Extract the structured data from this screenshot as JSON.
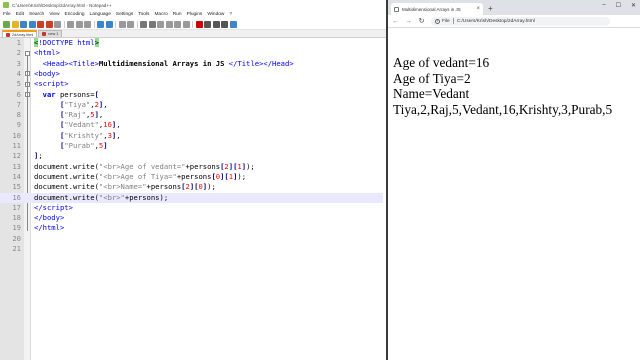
{
  "npp": {
    "window_title": "C:\\Users\\Krish\\Desktop\\2dArray.html - Notepad++",
    "menu": [
      "File",
      "Edit",
      "Search",
      "View",
      "Encoding",
      "Language",
      "Settings",
      "Tools",
      "Macro",
      "Run",
      "Plugins",
      "Window",
      "?"
    ],
    "tabs": [
      {
        "label": "2dArray.html",
        "active": true
      },
      {
        "label": "new 1",
        "active": false
      }
    ],
    "current_line": 16,
    "lines": [
      {
        "n": "1",
        "html": "<span class=\"hl-bracket\">&lt;</span><span class=\"tag\">!DOCTYPE html</span><span class=\"hl-bracket\">&gt;</span>"
      },
      {
        "n": "2",
        "html": "<span class=\"tag\">&lt;html&gt;</span>"
      },
      {
        "n": "3",
        "html": "  <span class=\"tag\">&lt;Head&gt;&lt;Title&gt;</span><b>Multidimensional Arrays in JS</b> <span class=\"tag\">&lt;/Title&gt;&lt;/Head&gt;</span>"
      },
      {
        "n": "4",
        "html": "<span class=\"tag\">&lt;body&gt;</span>"
      },
      {
        "n": "5",
        "html": "<span class=\"tag\">&lt;script&gt;</span>"
      },
      {
        "n": "6",
        "html": "  <span class=\"kw\">var</span> persons=<span class=\"op\">[</span>"
      },
      {
        "n": "7",
        "html": "      <span class=\"op\">[</span><span class=\"str\">\"Tiya\"</span>,<span class=\"num\">2</span><span class=\"op\">]</span>,"
      },
      {
        "n": "8",
        "html": "      <span class=\"op\">[</span><span class=\"str\">\"Raj\"</span>,<span class=\"num\">5</span><span class=\"op\">]</span>,"
      },
      {
        "n": "9",
        "html": "      <span class=\"op\">[</span><span class=\"str\">\"Vedant\"</span>,<span class=\"num\">16</span><span class=\"op\">]</span>,"
      },
      {
        "n": "10",
        "html": "      <span class=\"op\">[</span><span class=\"str\">\"Krishty\"</span>,<span class=\"num\">3</span><span class=\"op\">]</span>,"
      },
      {
        "n": "11",
        "html": "      <span class=\"op\">[</span><span class=\"str\">\"Purab\"</span>,<span class=\"num\">5</span><span class=\"op\">]</span>"
      },
      {
        "n": "12",
        "html": "<span class=\"op\">]</span>;"
      },
      {
        "n": "13",
        "html": "document.write(<span class=\"str\">\"&lt;br&gt;Age of vedant=\"</span>+persons<span class=\"op\">[</span><span class=\"num\">2</span><span class=\"op\">][</span><span class=\"num\">1</span><span class=\"op\">]</span>);"
      },
      {
        "n": "14",
        "html": "document.write(<span class=\"str\">\"&lt;br&gt;Age of Tiya=\"</span>+persons<span class=\"op\">[</span><span class=\"num\">0</span><span class=\"op\">][</span><span class=\"num\">1</span><span class=\"op\">]</span>);"
      },
      {
        "n": "15",
        "html": "document.write(<span class=\"str\">\"&lt;br&gt;Name=\"</span>+persons<span class=\"op\">[</span><span class=\"num\">2</span><span class=\"op\">][</span><span class=\"num\">0</span><span class=\"op\">]</span>);"
      },
      {
        "n": "16",
        "html": "document.write(<span class=\"str\">\"&lt;br&gt;\"</span>+persons);"
      },
      {
        "n": "17",
        "html": "<span class=\"tag\">&lt;/script&gt;</span>"
      },
      {
        "n": "18",
        "html": "<span class=\"tag\">&lt;/body&gt;</span>"
      },
      {
        "n": "19",
        "html": "<span class=\"tag\">&lt;/html&gt;</span>"
      },
      {
        "n": "20",
        "html": ""
      },
      {
        "n": "21",
        "html": ""
      }
    ]
  },
  "browser": {
    "tab_title": "Multidimensional Arrays in JS",
    "tab_close": "×",
    "new_tab": "+",
    "window_controls": [
      "–",
      "☐",
      "✕"
    ],
    "nav": {
      "back": "←",
      "forward": "→",
      "reload": "↻"
    },
    "address_prefix": "File",
    "address": "C:/Users/Krish/Desktop/2dArray.html",
    "output": [
      "Age of vedant=16",
      "Age of Tiya=2",
      "Name=Vedant",
      "Tiya,2,Raj,5,Vedant,16,Krishty,3,Purab,5"
    ]
  },
  "colors": {
    "editor_gutter": "#e4e4e4",
    "current_line": "#e8e8ff",
    "html_tag": "#0000ff",
    "string": "#808080",
    "number": "#ff0000",
    "tab_accent": "#f39c12",
    "chrome_tabstrip": "#dee1e6"
  }
}
